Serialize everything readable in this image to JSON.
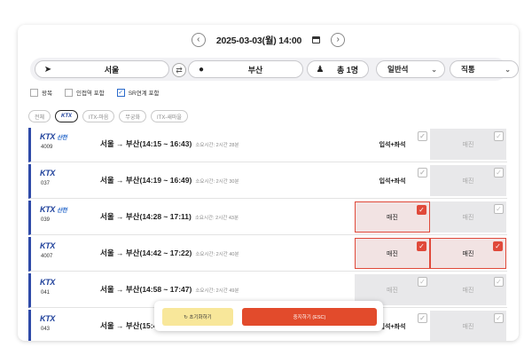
{
  "header": {
    "date": "2025-03-03(월) 14:00",
    "prev_label": "‹",
    "next_label": "›"
  },
  "search": {
    "origin": "서울",
    "destination": "부산",
    "passengers": "총 1명",
    "seat_class": "일반석",
    "route_type": "직통",
    "swap_label": "⇄"
  },
  "options": [
    {
      "label": "왕복",
      "checked": false
    },
    {
      "label": "인접역 포함",
      "checked": false
    },
    {
      "label": "SR연계 포함",
      "checked": true
    }
  ],
  "filters": [
    {
      "label": "전체",
      "active": false
    },
    {
      "label": "KTX",
      "active": true
    },
    {
      "label": "ITX-마음",
      "active": false
    },
    {
      "label": "무궁화",
      "active": false
    },
    {
      "label": "ITX-새마을",
      "active": false
    }
  ],
  "trains": [
    {
      "brand": "KTX",
      "sub": "산천",
      "number": "4009",
      "route": "서울 → 부산(14:15 ~ 16:43)",
      "duration": "소요시간: 2시간 28분",
      "general": "입석+좌석",
      "special": "매진",
      "general_state": "avail",
      "special_state": "sold",
      "general_checked": false,
      "special_checked": false
    },
    {
      "brand": "KTX",
      "sub": "",
      "number": "037",
      "route": "서울 → 부산(14:19 ~ 16:49)",
      "duration": "소요시간: 2시간 30분",
      "general": "입석+좌석",
      "special": "매진",
      "general_state": "avail",
      "special_state": "sold",
      "general_checked": false,
      "special_checked": false
    },
    {
      "brand": "KTX",
      "sub": "산천",
      "number": "039",
      "route": "서울 → 부산(14:28 ~ 17:11)",
      "duration": "소요시간: 2시간 43분",
      "general": "매진",
      "special": "매진",
      "general_state": "selected",
      "special_state": "sold",
      "general_checked": true,
      "special_checked": false
    },
    {
      "brand": "KTX",
      "sub": "",
      "number": "4007",
      "route": "서울 → 부산(14:42 ~ 17:22)",
      "duration": "소요시간: 2시간 40분",
      "general": "매진",
      "special": "매진",
      "general_state": "selected",
      "special_state": "selected",
      "general_checked": true,
      "special_checked": true
    },
    {
      "brand": "KTX",
      "sub": "",
      "number": "041",
      "route": "서울 → 부산(14:58 ~ 17:47)",
      "duration": "소요시간: 2시간 49분",
      "general": "매진",
      "special": "매진",
      "general_state": "sold",
      "special_state": "sold",
      "general_checked": false,
      "special_checked": false
    },
    {
      "brand": "KTX",
      "sub": "",
      "number": "043",
      "route": "서울 → 부산(15:45",
      "duration": "",
      "general": "입석+좌석",
      "special": "매진",
      "general_state": "avail",
      "special_state": "sold",
      "general_checked": false,
      "special_checked": false
    }
  ],
  "actions": {
    "reset_label": "↻ 초기화하기",
    "stop_label": "중지하기 (ESC)"
  }
}
